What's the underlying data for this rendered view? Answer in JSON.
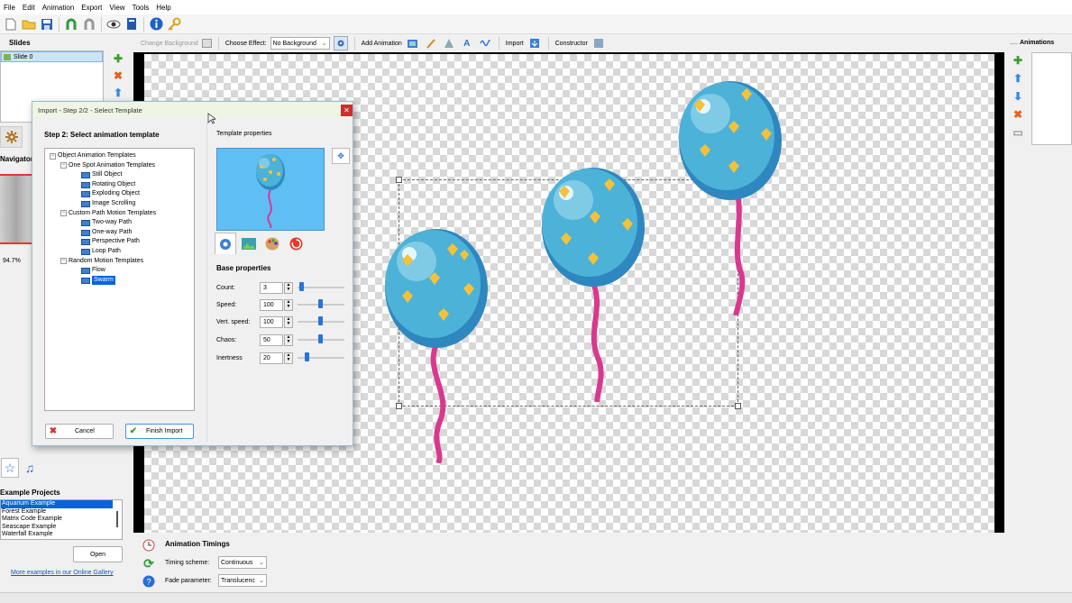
{
  "menu": [
    "File",
    "Edit",
    "Animation",
    "Export",
    "View",
    "Tools",
    "Help"
  ],
  "slides": {
    "title": "Slides",
    "items": [
      "Slide 0"
    ]
  },
  "navigator": {
    "title": "Navigator",
    "zoom": "94.7%"
  },
  "examples": {
    "title": "Example Projects",
    "items": [
      "Aquarium Example",
      "Forest Example",
      "Matrix Code Example",
      "Seascape Example",
      "Waterfall Example"
    ],
    "open": "Open",
    "more": "More examples in our Online Gallery"
  },
  "effectbar": {
    "change_bg": "Change Background",
    "choose_effect": "Choose Effect:",
    "effect_value": "No Background",
    "add_animation": "Add Animation",
    "import": "Import",
    "constructor": "Constructor"
  },
  "timings": {
    "title": "Animation Timings",
    "scheme_label": "Timing scheme:",
    "scheme_value": "Continuous",
    "fade_label": "Fade parameter:",
    "fade_value": "Translucenc"
  },
  "animations": {
    "title": "Animations"
  },
  "dialog": {
    "title": "Import - Step 2/2 - Select Template",
    "step": "Step 2: Select animation template",
    "tree": {
      "root": "Object Animation Templates",
      "groups": [
        {
          "label": "One Spot Animation Templates",
          "items": [
            "Still Object",
            "Rotating Object",
            "Exploding Object",
            "Image Scrolling"
          ]
        },
        {
          "label": "Custom Path Motion Templates",
          "items": [
            "Two-way Path",
            "One-way Path",
            "Perspective Path",
            "Loop Path"
          ]
        },
        {
          "label": "Random Motion Templates",
          "items": [
            "Flow",
            "Swarm"
          ]
        }
      ],
      "selected": "Swarm"
    },
    "template_props": "Template properties",
    "base_props": "Base properties",
    "props": [
      {
        "label": "Count:",
        "value": "3",
        "pos": 0.05
      },
      {
        "label": "Speed:",
        "value": "100",
        "pos": 0.48
      },
      {
        "label": "Vert. speed:",
        "value": "100",
        "pos": 0.48
      },
      {
        "label": "Chaos:",
        "value": "50",
        "pos": 0.48
      },
      {
        "label": "Inertness",
        "value": "20",
        "pos": 0.16
      }
    ],
    "cancel": "Cancel",
    "finish": "Finish Import"
  }
}
